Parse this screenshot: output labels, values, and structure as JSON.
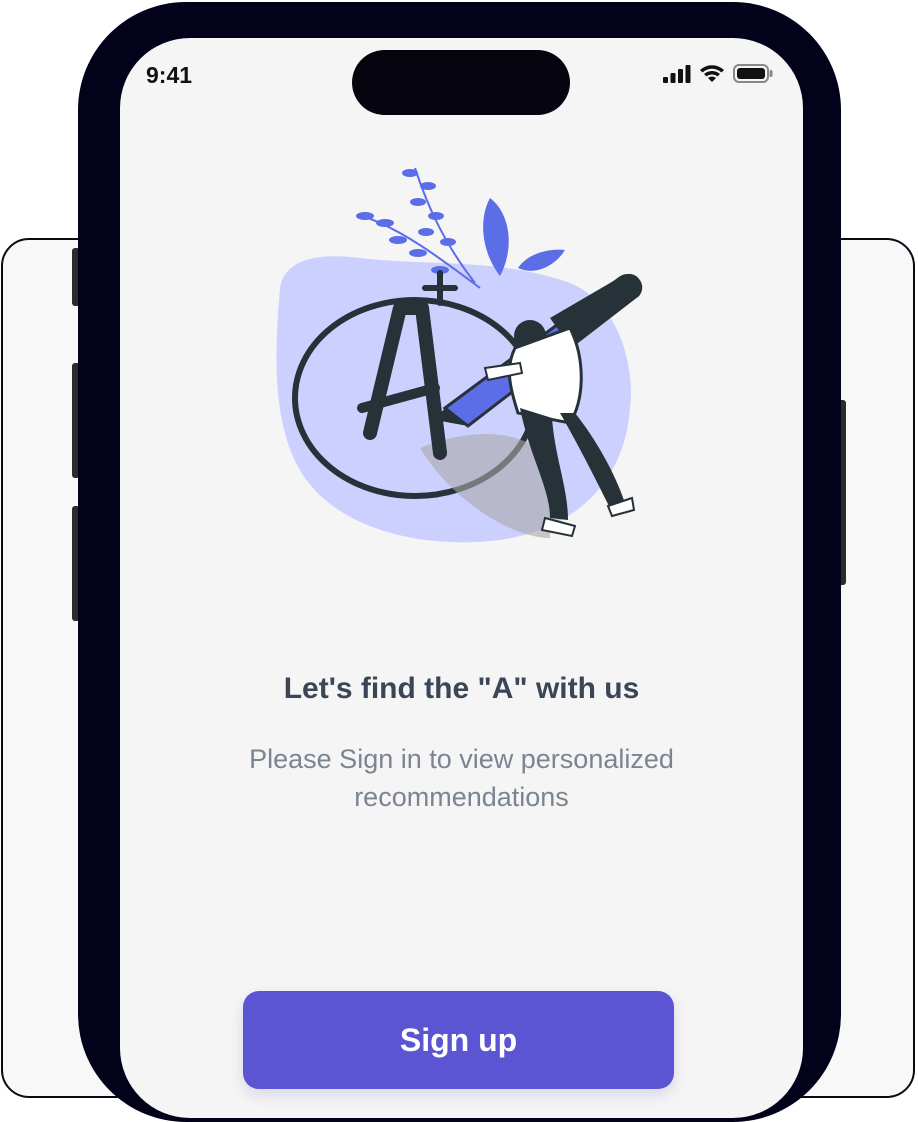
{
  "status_bar": {
    "time": "9:41",
    "icons": [
      "cellular-signal-icon",
      "wifi-icon",
      "battery-icon"
    ]
  },
  "illustration": {
    "name": "student-with-giant-pencil-grade-a-plus",
    "grade_text": "A+",
    "colors": {
      "blob": "#ccd0ff",
      "accent": "#5b6ee8",
      "ink": "#263238"
    }
  },
  "onboarding": {
    "title": "Let's find the \"A\" with us",
    "subtitle": "Please Sign in to view personalized recommendations"
  },
  "actions": {
    "signup_label": "Sign up"
  },
  "colors": {
    "primary": "#5b55d3",
    "title_text": "#3a4556",
    "subtitle_text": "#7b8592",
    "screen_bg": "#f5f5f5",
    "phone_frame": "#03021b"
  }
}
